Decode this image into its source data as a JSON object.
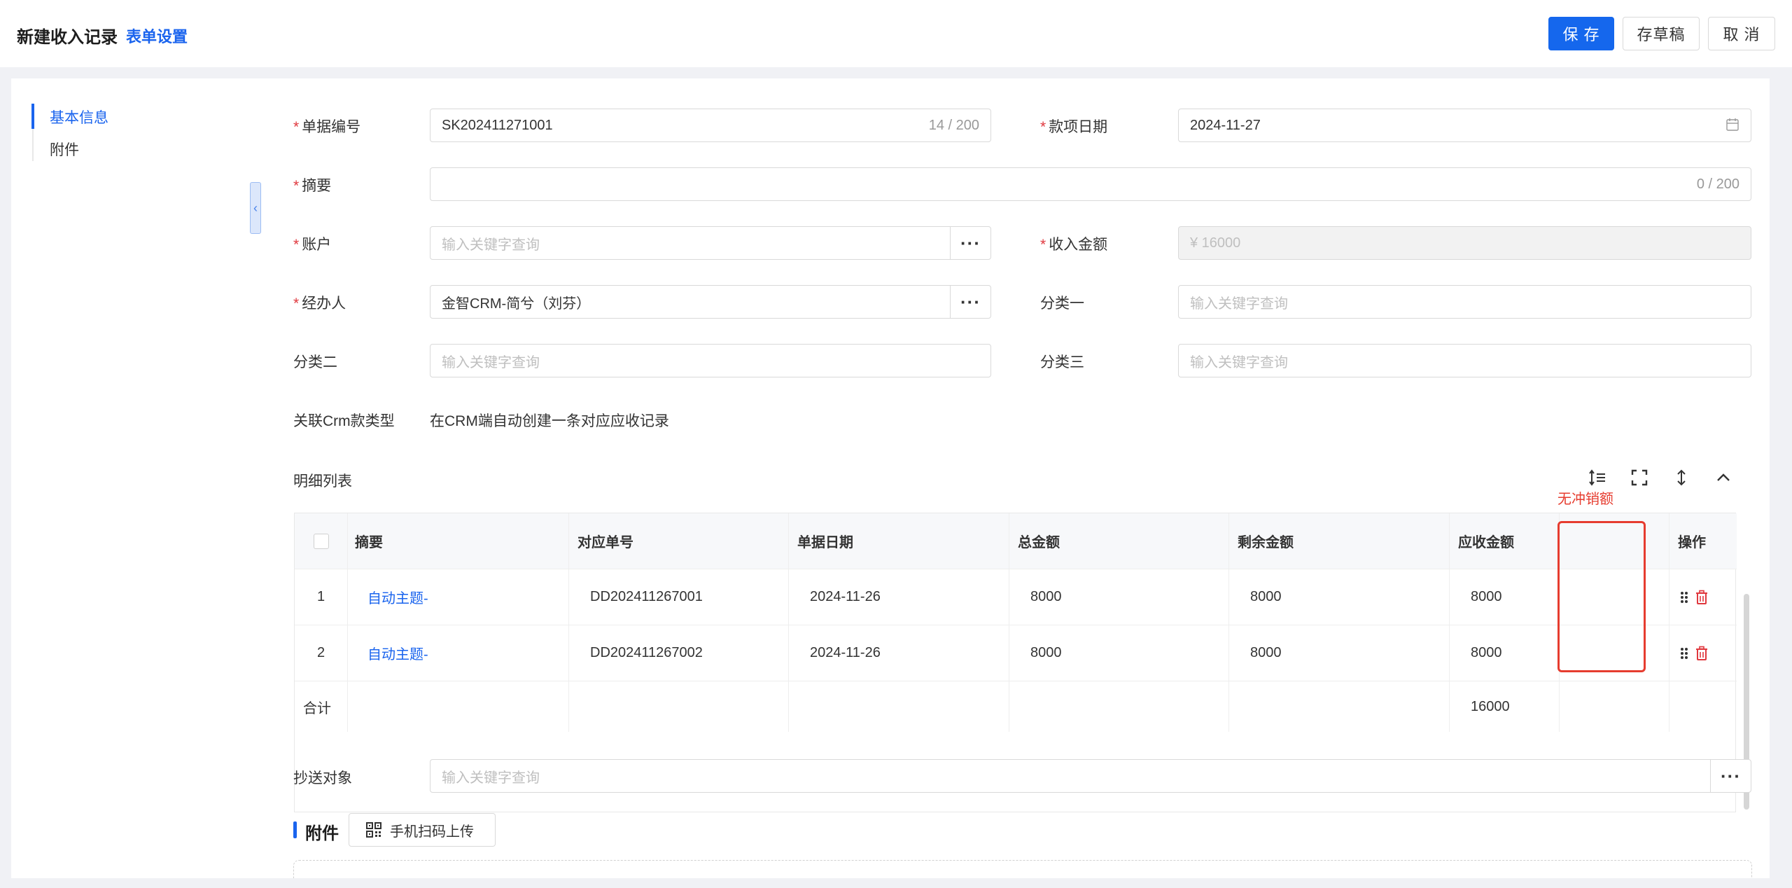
{
  "header": {
    "title": "新建收入记录",
    "form_settings": "表单设置",
    "save": "保 存",
    "draft": "存草稿",
    "cancel": "取 消"
  },
  "side_nav": {
    "items": [
      {
        "label": "基本信息",
        "active": true
      },
      {
        "label": "附件",
        "active": false
      }
    ]
  },
  "form": {
    "doc_no": {
      "label": "单据编号",
      "value": "SK202411271001",
      "counter": "14 / 200"
    },
    "payment_date": {
      "label": "款项日期",
      "value": "2024-11-27"
    },
    "summary": {
      "label": "摘要",
      "value": "",
      "counter": "0 / 200"
    },
    "account": {
      "label": "账户",
      "placeholder": "输入关键字查询"
    },
    "income_amount": {
      "label": "收入金额",
      "value": "¥ 16000"
    },
    "handler": {
      "label": "经办人",
      "value": "金智CRM-简兮（刘芬）"
    },
    "category1": {
      "label": "分类一",
      "placeholder": "输入关键字查询"
    },
    "category2": {
      "label": "分类二",
      "placeholder": "输入关键字查询"
    },
    "category3": {
      "label": "分类三",
      "placeholder": "输入关键字查询"
    },
    "crm_type": {
      "label": "关联Crm款类型",
      "value": "在CRM端自动创建一条对应应收记录"
    },
    "cc": {
      "label": "抄送对象",
      "placeholder": "输入关键字查询"
    }
  },
  "detail": {
    "title": "明细列表",
    "annotation": "无冲销额",
    "columns": [
      "摘要",
      "对应单号",
      "单据日期",
      "总金额",
      "剩余金额",
      "应收金额",
      "",
      "操作"
    ],
    "rows": [
      {
        "index": "1",
        "summary": "自动主题-",
        "order_no": "DD202411267001",
        "date": "2024-11-26",
        "total": "8000",
        "remaining": "8000",
        "receivable": "8000"
      },
      {
        "index": "2",
        "summary": "自动主题-",
        "order_no": "DD202411267002",
        "date": "2024-11-26",
        "total": "8000",
        "remaining": "8000",
        "receivable": "8000"
      }
    ],
    "total_label": "合计",
    "total_receivable": "16000"
  },
  "attachment": {
    "title": "附件",
    "scan_upload": "手机扫码上传"
  },
  "colors": {
    "primary": "#1567ed",
    "link": "#1a64ee",
    "required": "#e0383e",
    "annotation": "#e63c2f"
  }
}
